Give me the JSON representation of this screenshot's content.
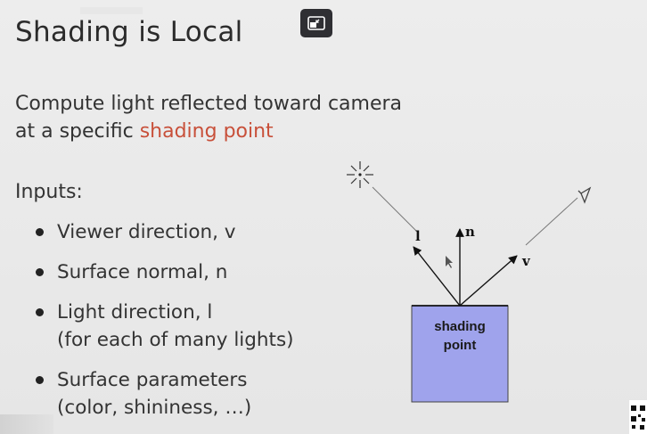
{
  "slide": {
    "title": "Shading is Local",
    "intro_line1": "Compute light reflected toward camera",
    "intro_line2_prefix": "at a specific ",
    "intro_line2_accent": "shading point",
    "inputs_heading": "Inputs:",
    "bullets": [
      {
        "line1": "Viewer direction, v",
        "line2": ""
      },
      {
        "line1": "Surface normal, n",
        "line2": ""
      },
      {
        "line1": "Light direction, l",
        "line2": "(for each of many lights)"
      },
      {
        "line1": "Surface parameters",
        "line2": "(color, shininess, …)"
      }
    ]
  },
  "diagram": {
    "label_l": "l",
    "label_n": "n",
    "label_v": "v",
    "box_line1": "shading",
    "box_line2": "point",
    "box_color": "#9fa3ec"
  },
  "controls": {
    "exit_fullscreen_icon": "exit-fullscreen-icon"
  },
  "colors": {
    "accent": "#c8503a",
    "background": "#ebebeb",
    "button_bg": "#2f2f33"
  }
}
